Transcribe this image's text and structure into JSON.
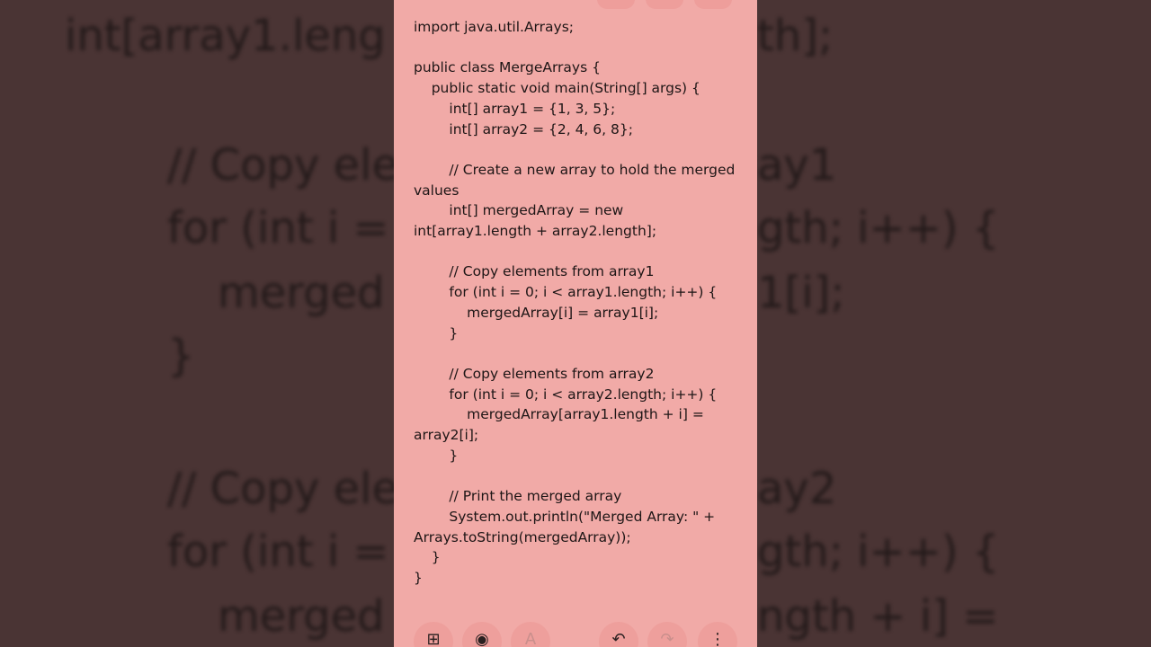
{
  "background_lines": [
    "int[array1.leng",
    "th];",
    "// Copy ele",
    "ay1",
    "for (int i =",
    "gth; i++) {",
    "merged",
    "1[i];",
    "}",
    "// Copy ele",
    "ay2",
    "for (int i =",
    "gth; i++) {",
    "merged",
    "ngth + i] ="
  ],
  "note": {
    "code_lines": [
      "import java.util.Arrays;",
      "",
      "public class MergeArrays {",
      "    public static void main(String[] args) {",
      "        int[] array1 = {1, 3, 5};",
      "        int[] array2 = {2, 4, 6, 8};",
      "",
      "        // Create a new array to hold the merged values",
      "        int[] mergedArray = new int[array1.length + array2.length];",
      "",
      "        // Copy elements from array1",
      "        for (int i = 0; i < array1.length; i++) {",
      "            mergedArray[i] = array1[i];",
      "        }",
      "",
      "        // Copy elements from array2",
      "        for (int i = 0; i < array2.length; i++) {",
      "            mergedArray[array1.length + i] = array2[i];",
      "        }",
      "",
      "        // Print the merged array",
      "        System.out.println(\"Merged Array: \" + Arrays.toString(mergedArray));",
      "    }",
      "}"
    ]
  },
  "toolbar": {
    "add_glyph": "⊞",
    "palette_glyph": "◉",
    "text_format_glyph": "A",
    "undo_glyph": "↶",
    "redo_glyph": "↷",
    "more_glyph": "⋮"
  },
  "colors": {
    "note_background": "#f1aaa7",
    "page_background": "#4a3434",
    "text": "#1e1616"
  }
}
